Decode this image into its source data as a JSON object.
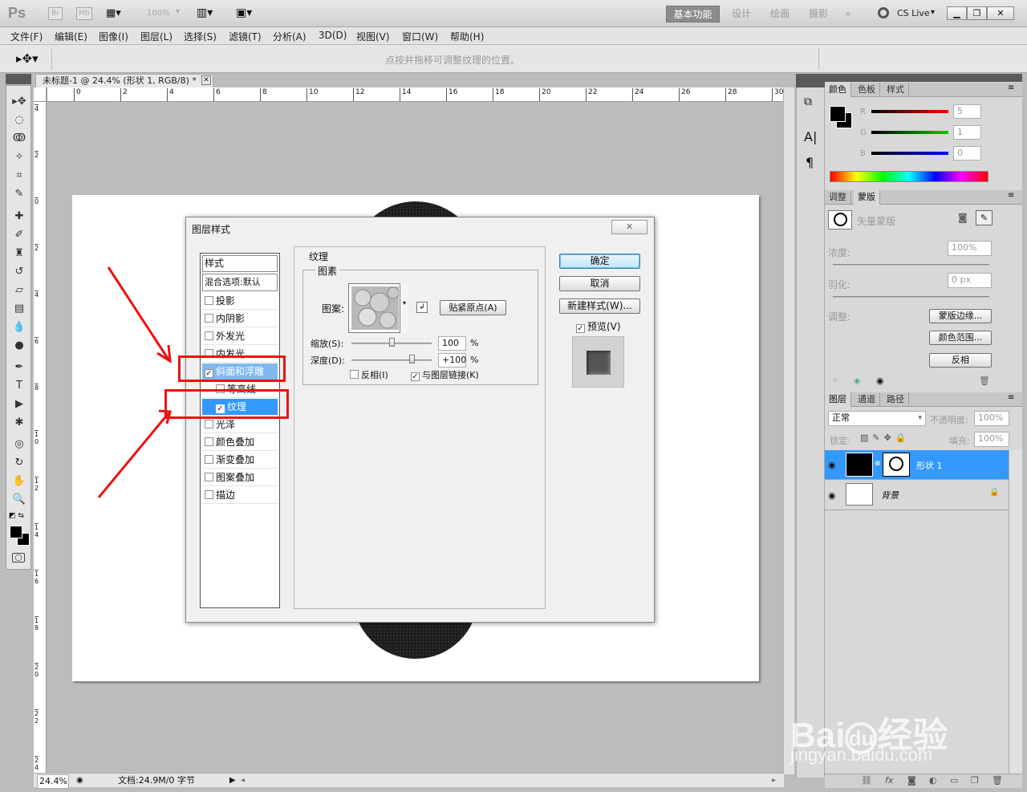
{
  "app": {
    "logo": "Ps",
    "bridge_btn": "Br",
    "minibridge_btn": "Mb",
    "zoom_display": "100%",
    "workspaces": [
      "基本功能",
      "设计",
      "绘画",
      "摄影"
    ],
    "cs_live": "CS Live"
  },
  "menu": [
    "文件(F)",
    "编辑(E)",
    "图像(I)",
    "图层(L)",
    "选择(S)",
    "滤镜(T)",
    "分析(A)",
    "3D(D)",
    "视图(V)",
    "窗口(W)",
    "帮助(H)"
  ],
  "options_bar": {
    "hint": "点按并拖移可调整纹理的位置。"
  },
  "document": {
    "tab_title": "未标题-1 @ 24.4% (形状 1, RGB/8) *",
    "ruler_h": [
      "0",
      "2",
      "4",
      "6",
      "8",
      "10",
      "12",
      "14",
      "16",
      "18",
      "20",
      "22",
      "24",
      "26",
      "28",
      "30"
    ],
    "ruler_v": [
      "4",
      "2",
      "0",
      "2",
      "4",
      "6",
      "8",
      "1\n0",
      "1\n2",
      "1\n4",
      "1\n6",
      "1\n8",
      "2\n0",
      "2\n2",
      "2\n4"
    ],
    "zoom": "24.4%",
    "doc_info": "文档:24.9M/0 字节"
  },
  "dialog": {
    "title": "图层样式",
    "style_list_header": "样式",
    "blend_options": "混合选项:默认",
    "items": [
      {
        "label": "投影",
        "checked": false,
        "selected": false
      },
      {
        "label": "内阴影",
        "checked": false,
        "selected": false
      },
      {
        "label": "外发光",
        "checked": false,
        "selected": false
      },
      {
        "label": "内发光",
        "checked": false,
        "selected": false
      },
      {
        "label": "斜面和浮雕",
        "checked": true,
        "selected": false
      },
      {
        "label": "等高线",
        "checked": false,
        "selected": false
      },
      {
        "label": "纹理",
        "checked": true,
        "selected": true
      },
      {
        "label": "光泽",
        "checked": false,
        "selected": false
      },
      {
        "label": "颜色叠加",
        "checked": false,
        "selected": false
      },
      {
        "label": "渐变叠加",
        "checked": false,
        "selected": false
      },
      {
        "label": "图案叠加",
        "checked": false,
        "selected": false
      },
      {
        "label": "描边",
        "checked": false,
        "selected": false
      }
    ],
    "section_title": "纹理",
    "group_title": "图素",
    "pattern_label": "图案:",
    "snap_button": "贴紧原点(A)",
    "scale_label": "缩放(S):",
    "scale_value": "100",
    "scale_unit": "%",
    "scale_level": 0.5,
    "depth_label": "深度(D):",
    "depth_value": "+100",
    "depth_unit": "%",
    "depth_level": 0.75,
    "invert_label": "反相(I)",
    "invert_checked": false,
    "link_label": "与图层链接(K)",
    "link_checked": true,
    "ok_button": "确定",
    "cancel_button": "取消",
    "new_style_button": "新建样式(W)...",
    "preview_label": "预览(V)",
    "preview_checked": true
  },
  "color_panel": {
    "tabs": [
      "颜色",
      "色板",
      "样式"
    ],
    "r_label": "R",
    "r_value": "5",
    "g_label": "G",
    "g_value": "1",
    "b_label": "B",
    "b_value": "0"
  },
  "mask_panel": {
    "tabs": [
      "调整",
      "蒙版"
    ],
    "mask_type": "矢量蒙版",
    "density_label": "浓度:",
    "density_value": "100%",
    "feather_label": "羽化:",
    "feather_value": "0 px",
    "refine_label": "调整:",
    "mask_edge_btn": "蒙版边缘...",
    "color_range_btn": "颜色范围...",
    "invert_btn": "反相"
  },
  "layers_panel": {
    "tabs": [
      "图层",
      "通道",
      "路径"
    ],
    "blend_mode": "正常",
    "opacity_label": "不透明度:",
    "opacity_value": "100%",
    "lock_label": "锁定:",
    "fill_label": "填充:",
    "fill_value": "100%",
    "layers": [
      {
        "name": "形状 1",
        "selected": true
      },
      {
        "name": "背景",
        "selected": false
      }
    ]
  },
  "watermark": {
    "brand": "Bai",
    "brand2": "du",
    "suffix": "经验",
    "url": "jingyan.baidu.com"
  }
}
